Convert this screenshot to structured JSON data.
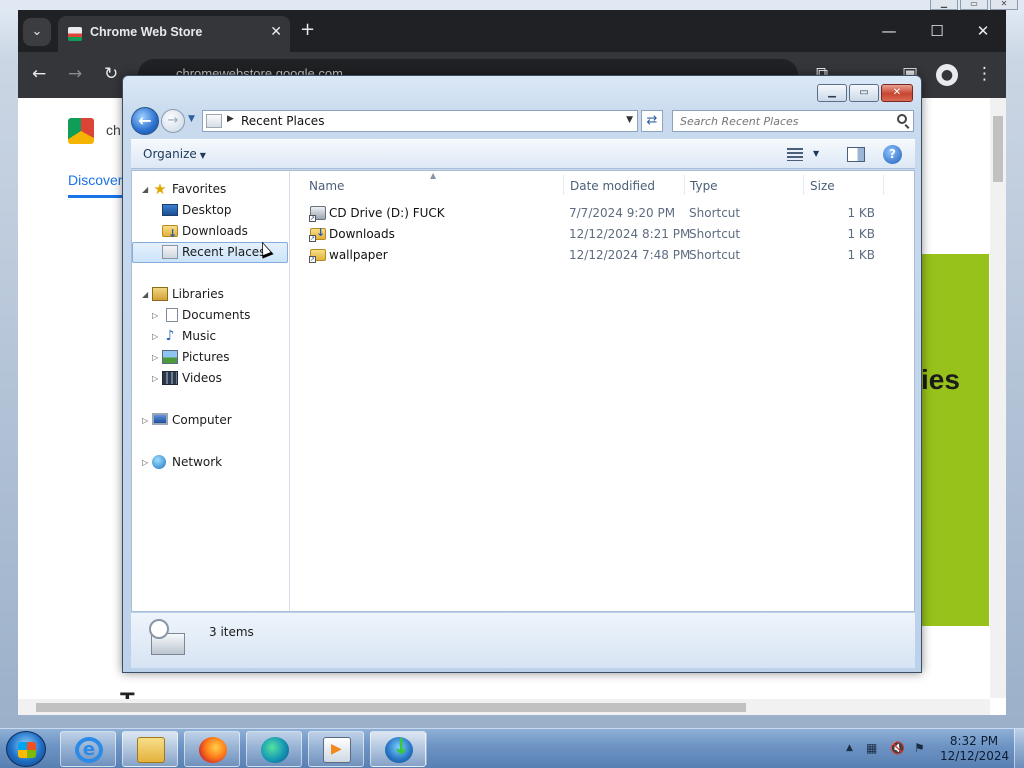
{
  "browser": {
    "tab_title": "Chrome Web Store",
    "tab_close": "✕",
    "new_tab": "+",
    "url": "chromewebstore.google.com",
    "window_buttons": {
      "minimize": "—",
      "maximize": "☐",
      "close": "✕"
    },
    "nav": {
      "back": "←",
      "forward": "→",
      "reload": "↻"
    },
    "page": {
      "store_name": "ch",
      "nav_tab": "Discover",
      "banner_text": "ies",
      "heading": "T"
    }
  },
  "explorer": {
    "address": "Recent Places",
    "search_placeholder": "Search Recent Places",
    "organize_label": "Organize",
    "help_glyph": "?",
    "win_buttons": {
      "minimize": "▁",
      "maximize": "▭",
      "close": "✕"
    },
    "sidebar": {
      "favorites": {
        "label": "Favorites",
        "items": [
          {
            "label": "Desktop",
            "icon": "desktop-icon"
          },
          {
            "label": "Downloads",
            "icon": "downloads-folder-icon"
          },
          {
            "label": "Recent Places",
            "icon": "recent-places-icon",
            "selected": true
          }
        ]
      },
      "libraries": {
        "label": "Libraries",
        "items": [
          {
            "label": "Documents",
            "icon": "documents-icon"
          },
          {
            "label": "Music",
            "icon": "music-icon"
          },
          {
            "label": "Pictures",
            "icon": "pictures-icon"
          },
          {
            "label": "Videos",
            "icon": "videos-icon"
          }
        ]
      },
      "computer": {
        "label": "Computer"
      },
      "network": {
        "label": "Network"
      }
    },
    "columns": [
      "Name",
      "Date modified",
      "Type",
      "Size"
    ],
    "files": [
      {
        "name": "CD Drive (D:) FUCK",
        "date": "7/7/2024 9:20 PM",
        "type": "Shortcut",
        "size": "1 KB",
        "icon": "cd-drive-icon"
      },
      {
        "name": "Downloads",
        "date": "12/12/2024 8:21 PM",
        "type": "Shortcut",
        "size": "1 KB",
        "icon": "downloads-folder-icon"
      },
      {
        "name": "wallpaper",
        "date": "12/12/2024 7:48 PM",
        "type": "Shortcut",
        "size": "1 KB",
        "icon": "folder-icon"
      }
    ],
    "status": "3 items"
  },
  "taskbar": {
    "time": "8:32 PM",
    "date": "12/12/2024",
    "tray_glyphs": {
      "show_hidden": "▲",
      "flag": "⚑"
    }
  },
  "colors": {
    "chrome_dark": "#202124",
    "accent_green": "#97c11b",
    "link_blue": "#1a73e8",
    "selection_blue": "#cce4f9"
  }
}
